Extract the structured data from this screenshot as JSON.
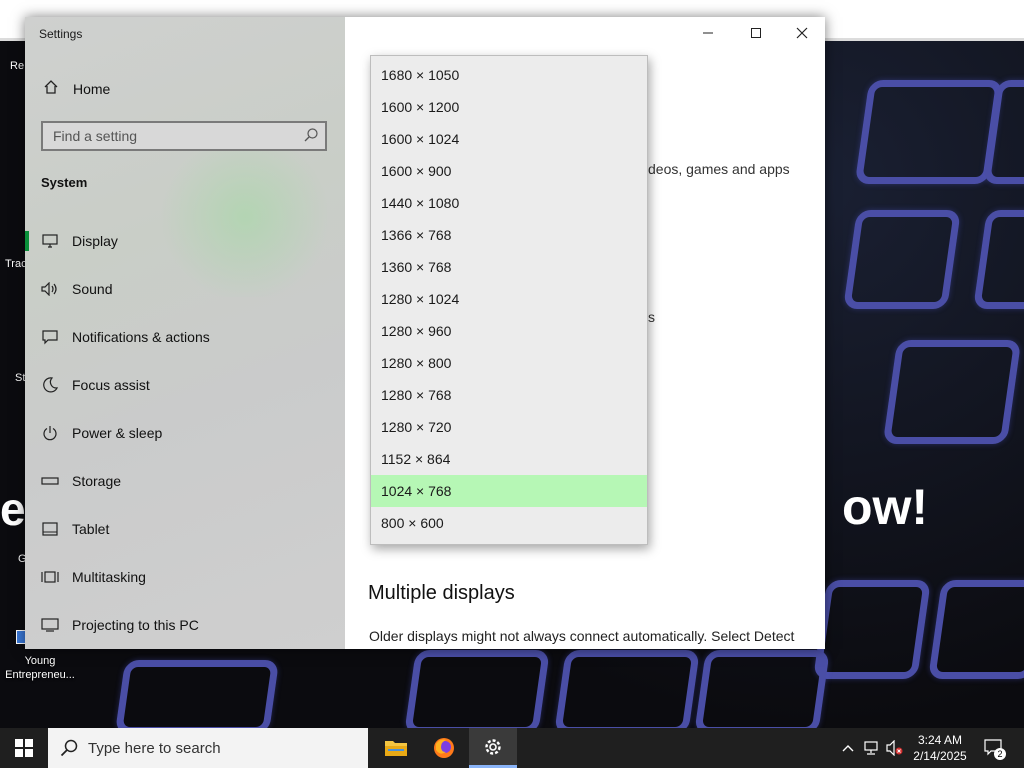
{
  "window": {
    "title": "Settings"
  },
  "sidebar": {
    "home_label": "Home",
    "search_placeholder": "Find a setting",
    "section_title": "System",
    "items": [
      {
        "label": "Display",
        "icon": "monitor-icon",
        "active": true
      },
      {
        "label": "Sound",
        "icon": "speaker-icon"
      },
      {
        "label": "Notifications & actions",
        "icon": "notification-icon"
      },
      {
        "label": "Focus assist",
        "icon": "moon-icon"
      },
      {
        "label": "Power & sleep",
        "icon": "power-icon"
      },
      {
        "label": "Storage",
        "icon": "storage-icon"
      },
      {
        "label": "Tablet",
        "icon": "tablet-icon"
      },
      {
        "label": "Multitasking",
        "icon": "multitasking-icon"
      },
      {
        "label": "Projecting to this PC",
        "icon": "projecting-icon"
      }
    ]
  },
  "content": {
    "frag_videos": "deos, games and apps",
    "frag_s": "s",
    "multiple_displays_heading": "Multiple displays",
    "multiple_displays_text": "Older displays might not always connect automatically. Select Detect"
  },
  "resolution_dropdown": {
    "options": [
      "1680 × 1050",
      "1600 × 1200",
      "1600 × 1024",
      "1600 × 900",
      "1440 × 1080",
      "1366 × 768",
      "1360 × 768",
      "1280 × 1024",
      "1280 × 960",
      "1280 × 800",
      "1280 × 768",
      "1280 × 720",
      "1152 × 864",
      "1024 × 768",
      "800 × 600"
    ],
    "selected": "1024 × 768"
  },
  "desktop": {
    "icon_label": "Young Entrepreneu...",
    "bg_text": "ow!",
    "side_fragments": [
      "Re",
      "Trac",
      "St",
      "e",
      "G"
    ]
  },
  "taskbar": {
    "search_placeholder": "Type here to search",
    "time": "3:24 AM",
    "date": "2/14/2025",
    "notification_count": "2"
  },
  "colors": {
    "accent": "#0a8f3a",
    "selected_option": "#b6f7b5",
    "taskbar": "#1f1f1f"
  }
}
